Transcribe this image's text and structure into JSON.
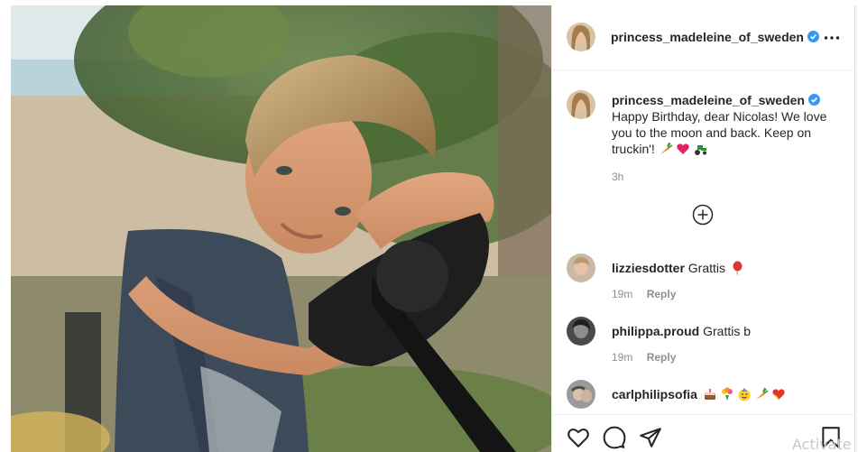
{
  "post": {
    "author": "princess_madeleine_of_sweden",
    "verified": true,
    "caption": "Happy Birthday, dear Nicolas! We love you to the moon and back. Keep on truckin'!",
    "caption_emojis": [
      "carrot-emoji",
      "red-heart-emoji",
      "tractor-emoji"
    ],
    "time_ago": "3h"
  },
  "comments": [
    {
      "username": "lizziesdotter",
      "text": "Grattis",
      "emojis": [
        "balloon-emoji"
      ],
      "time": "19m",
      "reply_label": "Reply"
    },
    {
      "username": "philippa.proud",
      "text": "Grattis b",
      "emojis": [],
      "time": "19m",
      "reply_label": "Reply"
    },
    {
      "username": "carlphilipsofia",
      "text": "",
      "emojis": [
        "cake-emoji",
        "bouquet-emoji",
        "party-face-emoji",
        "carrot-emoji",
        "heart-emoji"
      ]
    }
  ],
  "overlay": {
    "watermark": "Activate"
  },
  "colors": {
    "verified": "#3897f0",
    "text": "#262626",
    "muted": "#8e8e8e"
  }
}
